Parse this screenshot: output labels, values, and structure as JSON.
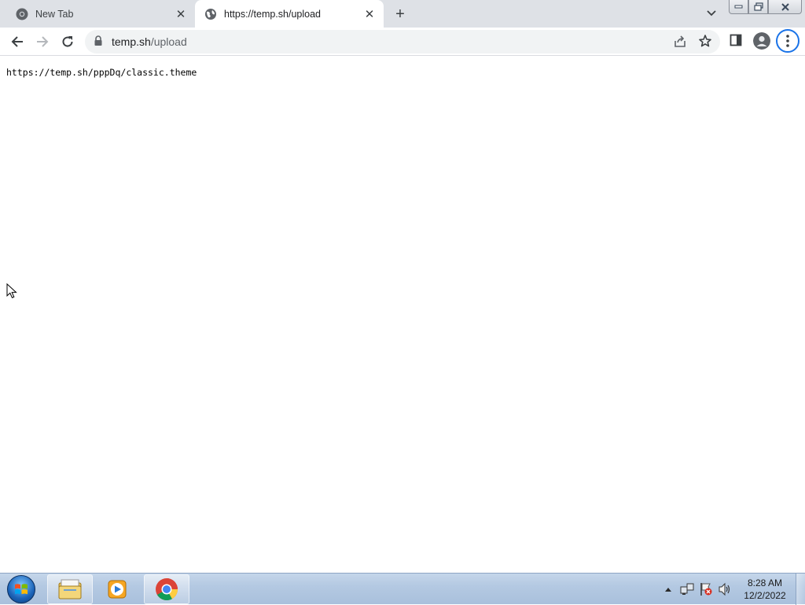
{
  "browser": {
    "tabs": [
      {
        "title": "New Tab",
        "favicon": "chrome-icon",
        "active": false
      },
      {
        "title": "https://temp.sh/upload",
        "favicon": "globe-icon",
        "active": true
      }
    ],
    "new_tab_label": "+",
    "address_bar": {
      "host": "temp.sh",
      "path": "/upload"
    }
  },
  "page": {
    "response_text": "https://temp.sh/pppDq/classic.theme"
  },
  "taskbar": {
    "pinned": [
      {
        "name": "file-explorer-icon"
      },
      {
        "name": "media-player-icon"
      },
      {
        "name": "chrome-icon",
        "active": true
      }
    ],
    "clock": {
      "time": "8:28 AM",
      "date": "12/2/2022"
    }
  },
  "colors": {
    "tab_strip": "#dee1e6",
    "omnibox": "#f1f3f4",
    "accent": "#1a73e8",
    "taskbar": "#b4c9e2"
  }
}
